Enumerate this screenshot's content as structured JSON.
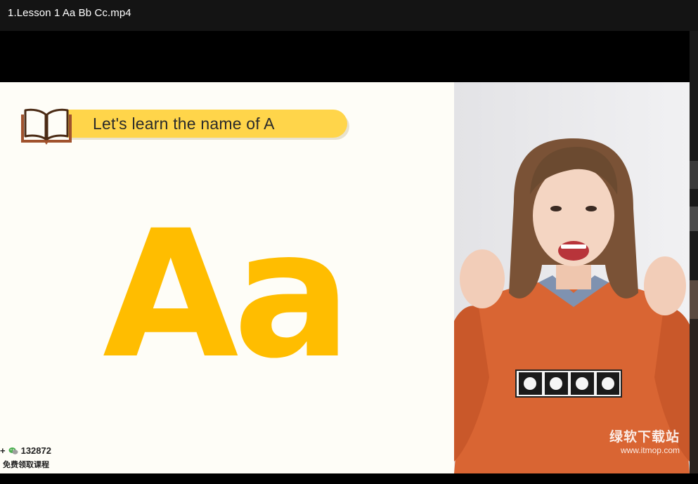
{
  "window": {
    "title": "1.Lesson 1 Aa Bb Cc.mp4"
  },
  "slide": {
    "banner_text": "Let's learn the name of A",
    "big_letters": "Aa",
    "wechat_prefix": "+",
    "wechat_number": "132872",
    "promo_text": "免费领取课程",
    "colors": {
      "background": "#fefdf7",
      "banner": "#ffd54a",
      "letters": "#ffbd00",
      "book": "#a0522d"
    }
  },
  "presenter": {
    "watermark_title": "绿软下载站",
    "watermark_url": "www.itmop.com"
  },
  "icons": {
    "book": "open-book-icon",
    "wechat": "wechat-icon"
  }
}
